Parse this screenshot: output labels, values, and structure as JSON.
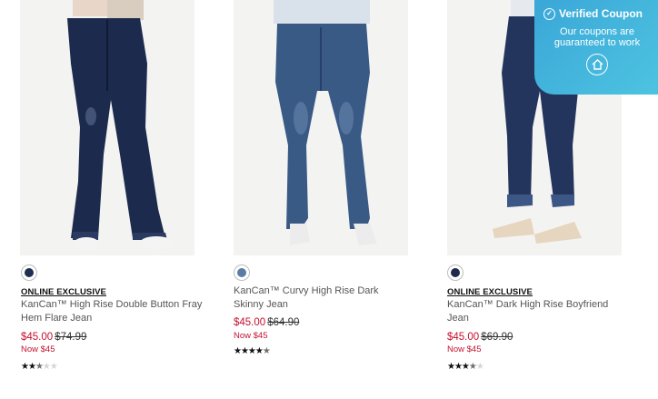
{
  "products": [
    {
      "badge": "ONLINE EXCLUSIVE",
      "title": "KanCan™ High Rise Double Button Fray Hem Flare Jean",
      "sale_price": "$45.00",
      "original_price": "$74.99",
      "now_price": "Now $45",
      "rating": 2.5,
      "stars": "★★★★★",
      "swatch_color": "#1e2f52"
    },
    {
      "badge": "",
      "title": "KanCan™ Curvy High Rise Dark Skinny Jean",
      "sale_price": "$45.00",
      "original_price": "$64.90",
      "now_price": "Now $45",
      "rating": 4.5,
      "stars": "★★★★★",
      "swatch_color": "#5b7aa6"
    },
    {
      "badge": "ONLINE EXCLUSIVE",
      "title": "KanCan™ Dark High Rise Boyfriend Jean",
      "sale_price": "$45.00",
      "original_price": "$69.90",
      "now_price": "Now $45",
      "rating": 3.5,
      "stars": "★★★★★",
      "swatch_color": "#1d2a4a"
    }
  ],
  "coupon": {
    "title": "Verified Coupon",
    "subtitle": "Our coupons are guaranteed to work",
    "color": "#3aa7d8"
  }
}
